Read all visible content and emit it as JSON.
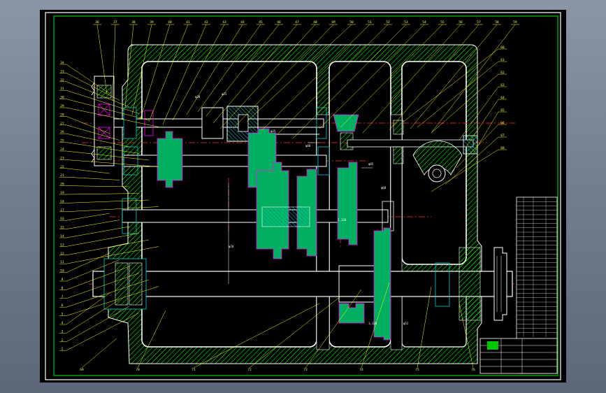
{
  "colors": {
    "background": "#000000",
    "frame": "#ffffff",
    "border_green": "#00c800",
    "housing_hatch": "#00ff00",
    "centerline": "#ff3030",
    "gear_fill": "#00b060",
    "gear_outline": "#ff00ff",
    "bearing": "#00d0d0",
    "leader": "#ffff00",
    "outer_gradient_top": "#8a96a6",
    "outer_gradient_bottom": "#5c6879"
  },
  "drawing": {
    "type": "gearbox-assembly-cross-section",
    "top_callouts": [
      "36",
      "37",
      "38",
      "39",
      "40",
      "41",
      "42",
      "43",
      "44",
      "45",
      "46",
      "47",
      "48",
      "49",
      "50",
      "51",
      "52",
      "53",
      "54",
      "55",
      "56",
      "57",
      "58",
      "59"
    ],
    "right_callouts": [
      "60",
      "61",
      "62",
      "63",
      "64",
      "65",
      "66",
      "67",
      "68"
    ],
    "left_callouts": [
      "34",
      "33",
      "32",
      "31",
      "30",
      "29",
      "28",
      "27",
      "26",
      "25",
      "24",
      "23",
      "22",
      "21",
      "20",
      "19",
      "18",
      "17",
      "16",
      "15",
      "14",
      "13",
      "12",
      "11",
      "10",
      "9",
      "8",
      "7",
      "6",
      "5",
      "4",
      "3",
      "2",
      "1"
    ],
    "bottom_callouts": [
      "69",
      "70",
      "71",
      "72",
      "73",
      "74",
      "75",
      "76"
    ],
    "dimension_labels": [
      "φ30",
      "φ25",
      "φ35",
      "φ40",
      "φ45",
      "φ60",
      "φ70",
      "1,120",
      "1,120",
      "φ52"
    ],
    "parts_table_rows": 32
  }
}
